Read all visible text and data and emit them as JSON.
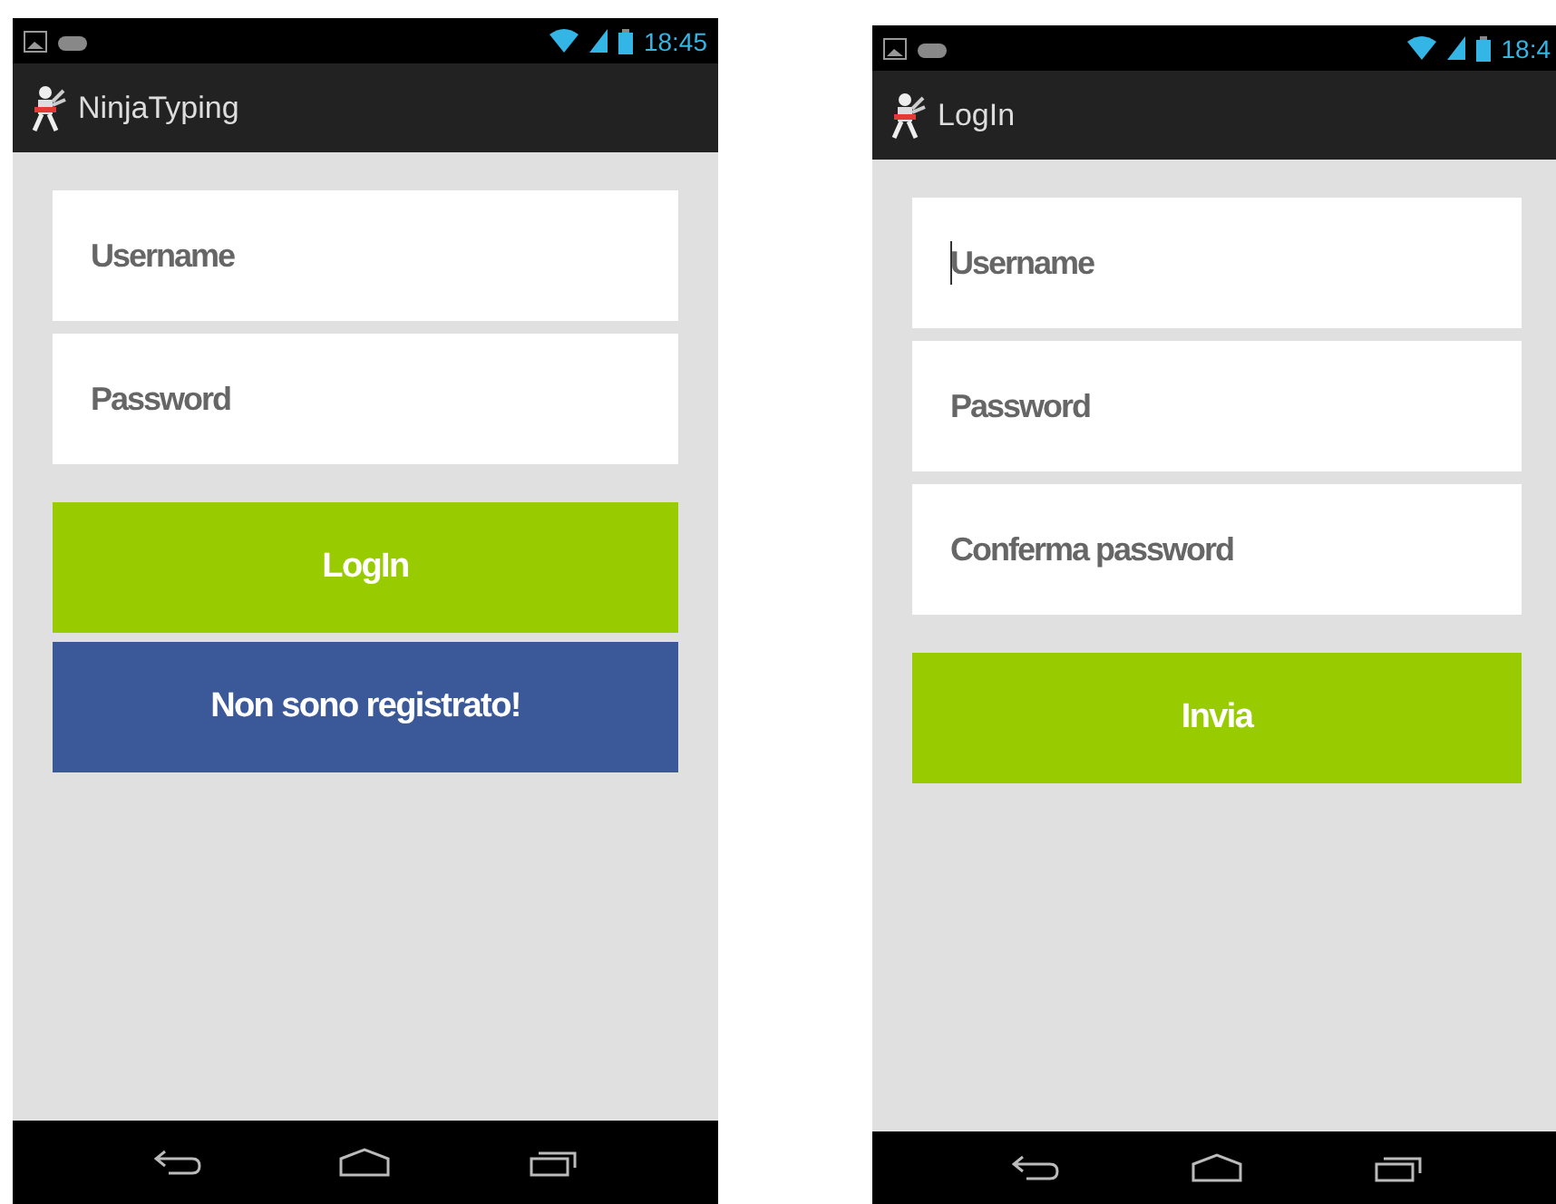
{
  "phones": [
    {
      "status_bar": {
        "time": "18:45"
      },
      "action_bar": {
        "title": "NinjaTyping"
      },
      "fields": [
        {
          "placeholder": "Username",
          "focused": false
        },
        {
          "placeholder": "Password",
          "focused": false
        }
      ],
      "buttons": [
        {
          "label": "LogIn",
          "kind": "primary"
        },
        {
          "label": "Non sono registrato!",
          "kind": "secondary"
        }
      ]
    },
    {
      "status_bar": {
        "time": "18:4"
      },
      "action_bar": {
        "title": "LogIn"
      },
      "fields": [
        {
          "placeholder": "Username",
          "focused": true
        },
        {
          "placeholder": "Password",
          "focused": false
        },
        {
          "placeholder": "Conferma password",
          "focused": false
        }
      ],
      "buttons": [
        {
          "label": "Invia",
          "kind": "primary"
        }
      ]
    }
  ]
}
